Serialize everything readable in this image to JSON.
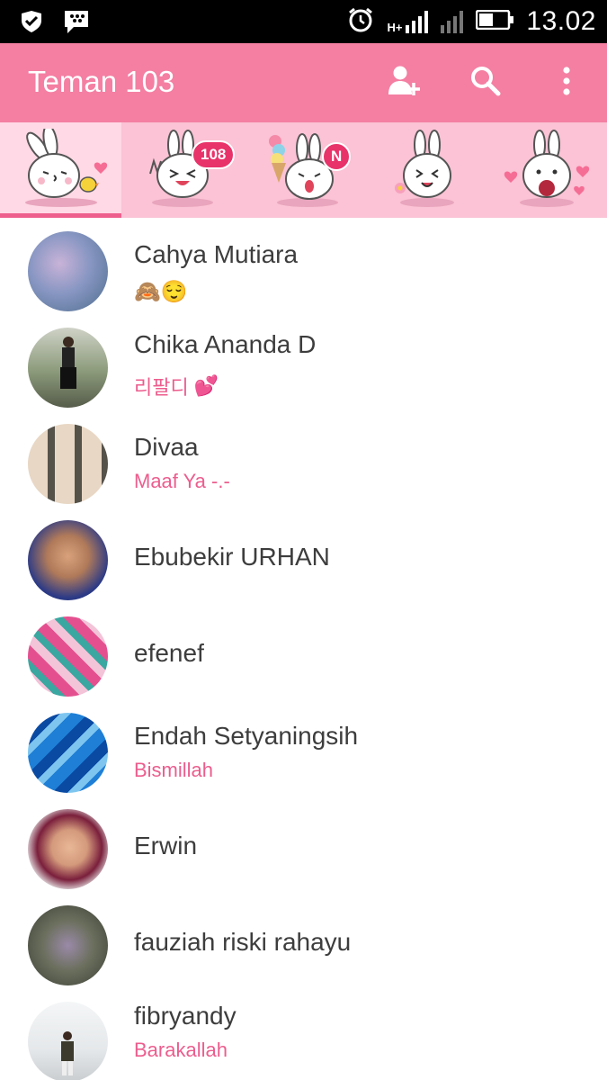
{
  "status_bar": {
    "time": "13.02",
    "network_label": "H+",
    "colors": {
      "background": "#000000",
      "foreground": "#ffffff"
    }
  },
  "app_bar": {
    "title": "Teman 103",
    "actions": [
      "add-friend-icon",
      "search-icon",
      "more-vert-icon"
    ],
    "color": "#f47fa3"
  },
  "tabs": {
    "active_index": 0,
    "items": [
      {
        "sticker": "bunny-kiss-sticker",
        "badge": ""
      },
      {
        "sticker": "bunny-peace-sticker",
        "badge": "108"
      },
      {
        "sticker": "bunny-icecream-sticker",
        "badge": "N"
      },
      {
        "sticker": "bunny-flower-sticker",
        "badge": ""
      },
      {
        "sticker": "bunny-hearts-sticker",
        "badge": ""
      }
    ],
    "colors": {
      "bar": "#fbc3d5",
      "indicator": "#ee5f8d",
      "badge": "#e8336a"
    }
  },
  "friends": [
    {
      "name": "Cahya Mutiara",
      "status": "",
      "emoji": "🙈😌"
    },
    {
      "name": "Chika Ananda D",
      "status": "리팔디",
      "emoji": "💕"
    },
    {
      "name": "Divaa",
      "status": "Maaf Ya -.-",
      "emoji": ""
    },
    {
      "name": "Ebubekir URHAN",
      "status": "",
      "emoji": ""
    },
    {
      "name": "efenef",
      "status": "",
      "emoji": ""
    },
    {
      "name": "Endah Setyaningsih",
      "status": "Bismillah",
      "emoji": ""
    },
    {
      "name": "Erwin",
      "status": "",
      "emoji": ""
    },
    {
      "name": "fauziah riski rahayu",
      "status": "",
      "emoji": ""
    },
    {
      "name": "fibryandy",
      "status": "Barakallah",
      "emoji": ""
    }
  ],
  "accent_color": "#ec5d8e"
}
